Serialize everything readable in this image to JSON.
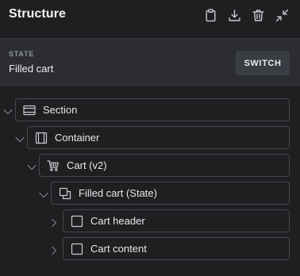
{
  "panel": {
    "title": "Structure"
  },
  "toolbar": {
    "icons": [
      "clipboard-icon",
      "download-icon",
      "trash-icon",
      "collapse-icon"
    ]
  },
  "state": {
    "caption": "STATE",
    "value": "Filled cart",
    "switch_label": "SWITCH"
  },
  "tree": {
    "nodes": [
      {
        "label": "Section",
        "icon": "section-icon",
        "expanded": true
      },
      {
        "label": "Container",
        "icon": "container-icon",
        "expanded": true
      },
      {
        "label": "Cart (v2)",
        "icon": "cart-icon",
        "expanded": true
      },
      {
        "label": "Filled cart (State)",
        "icon": "state-icon",
        "expanded": true
      },
      {
        "label": "Cart header",
        "icon": "block-icon",
        "expanded": false
      },
      {
        "label": "Cart content",
        "icon": "block-icon",
        "expanded": false
      }
    ]
  },
  "colors": {
    "background": "#1e1f21",
    "state_bar": "#2b2d31",
    "border": "#44474d",
    "text": "#e6e7ea",
    "muted": "#8f949c"
  }
}
